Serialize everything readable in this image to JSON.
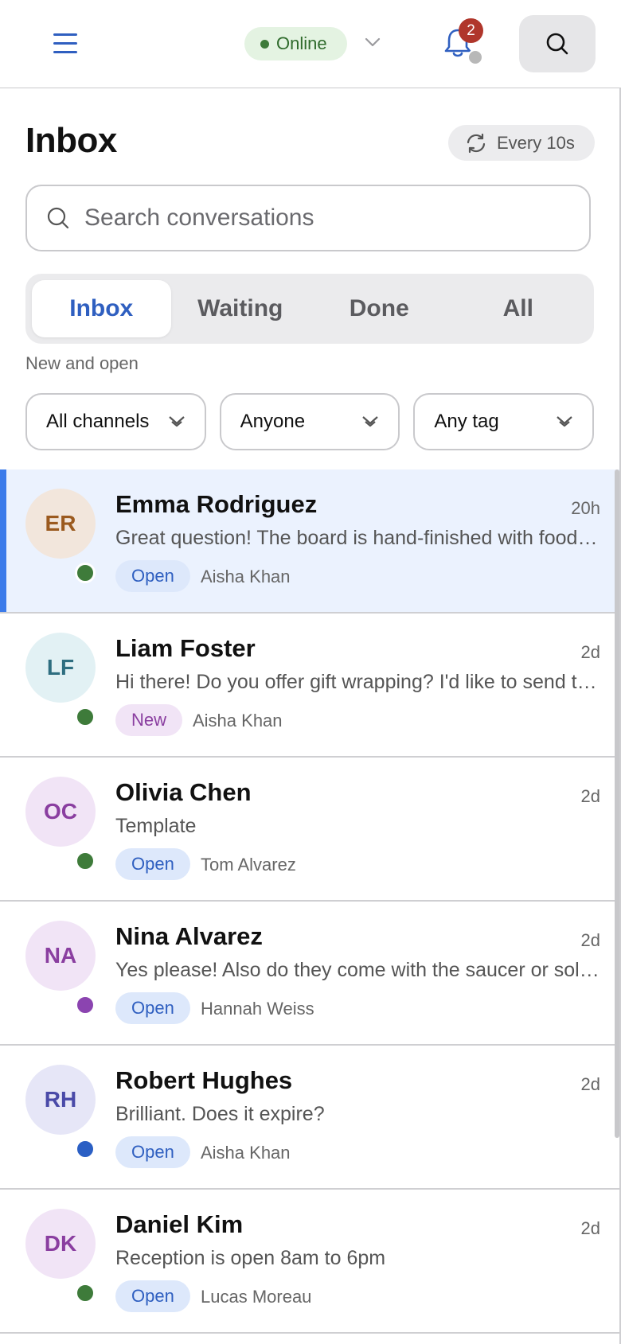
{
  "topbar": {
    "status": "Online",
    "notification_count": "2"
  },
  "inbox": {
    "title": "Inbox",
    "refresh_label": "Every 10s",
    "search_placeholder": "Search conversations",
    "tabs": [
      "Inbox",
      "Waiting",
      "Done",
      "All"
    ],
    "active_tab": "Inbox",
    "tab_caption": "New and open",
    "filters": [
      "All channels",
      "Anyone",
      "Any tag"
    ]
  },
  "conversations": [
    {
      "initials": "ER",
      "name": "Emma Rodriguez",
      "time": "20h",
      "preview": "Great question! The board is hand-finished with food-safe oil",
      "status": "Open",
      "assignee": "Aisha Khan",
      "avatar_bg": "#f2e6dc",
      "avatar_fg": "#9b5a1f",
      "presence": "#3e7b3a",
      "selected": true
    },
    {
      "initials": "LF",
      "name": "Liam Foster",
      "time": "2d",
      "preview": "Hi there! Do you offer gift wrapping? I'd like to send this as a gift",
      "status": "New",
      "assignee": "Aisha Khan",
      "avatar_bg": "#e2f1f4",
      "avatar_fg": "#2e6e80",
      "presence": "#3e7b3a",
      "selected": false
    },
    {
      "initials": "OC",
      "name": "Olivia Chen",
      "time": "2d",
      "preview": "Template",
      "status": "Open",
      "assignee": "Tom Alvarez",
      "avatar_bg": "#f1e4f6",
      "avatar_fg": "#8a3ea0",
      "presence": "#3e7b3a",
      "selected": false
    },
    {
      "initials": "NA",
      "name": "Nina Alvarez",
      "time": "2d",
      "preview": "Yes please! Also do they come with the saucer or sold separately?",
      "status": "Open",
      "assignee": "Hannah Weiss",
      "avatar_bg": "#f1e4f6",
      "avatar_fg": "#8a3ea0",
      "presence": "#8b44b0",
      "selected": false
    },
    {
      "initials": "RH",
      "name": "Robert Hughes",
      "time": "2d",
      "preview": "Brilliant. Does it expire?",
      "status": "Open",
      "assignee": "Aisha Khan",
      "avatar_bg": "#e6e6f7",
      "avatar_fg": "#4a4aa8",
      "presence": "#2b5fc4",
      "selected": false
    },
    {
      "initials": "DK",
      "name": "Daniel Kim",
      "time": "2d",
      "preview": "Reception is open 8am to 6pm",
      "status": "Open",
      "assignee": "Lucas Moreau",
      "avatar_bg": "#f1e4f6",
      "avatar_fg": "#8a3ea0",
      "presence": "#3e7b3a",
      "selected": false
    }
  ]
}
